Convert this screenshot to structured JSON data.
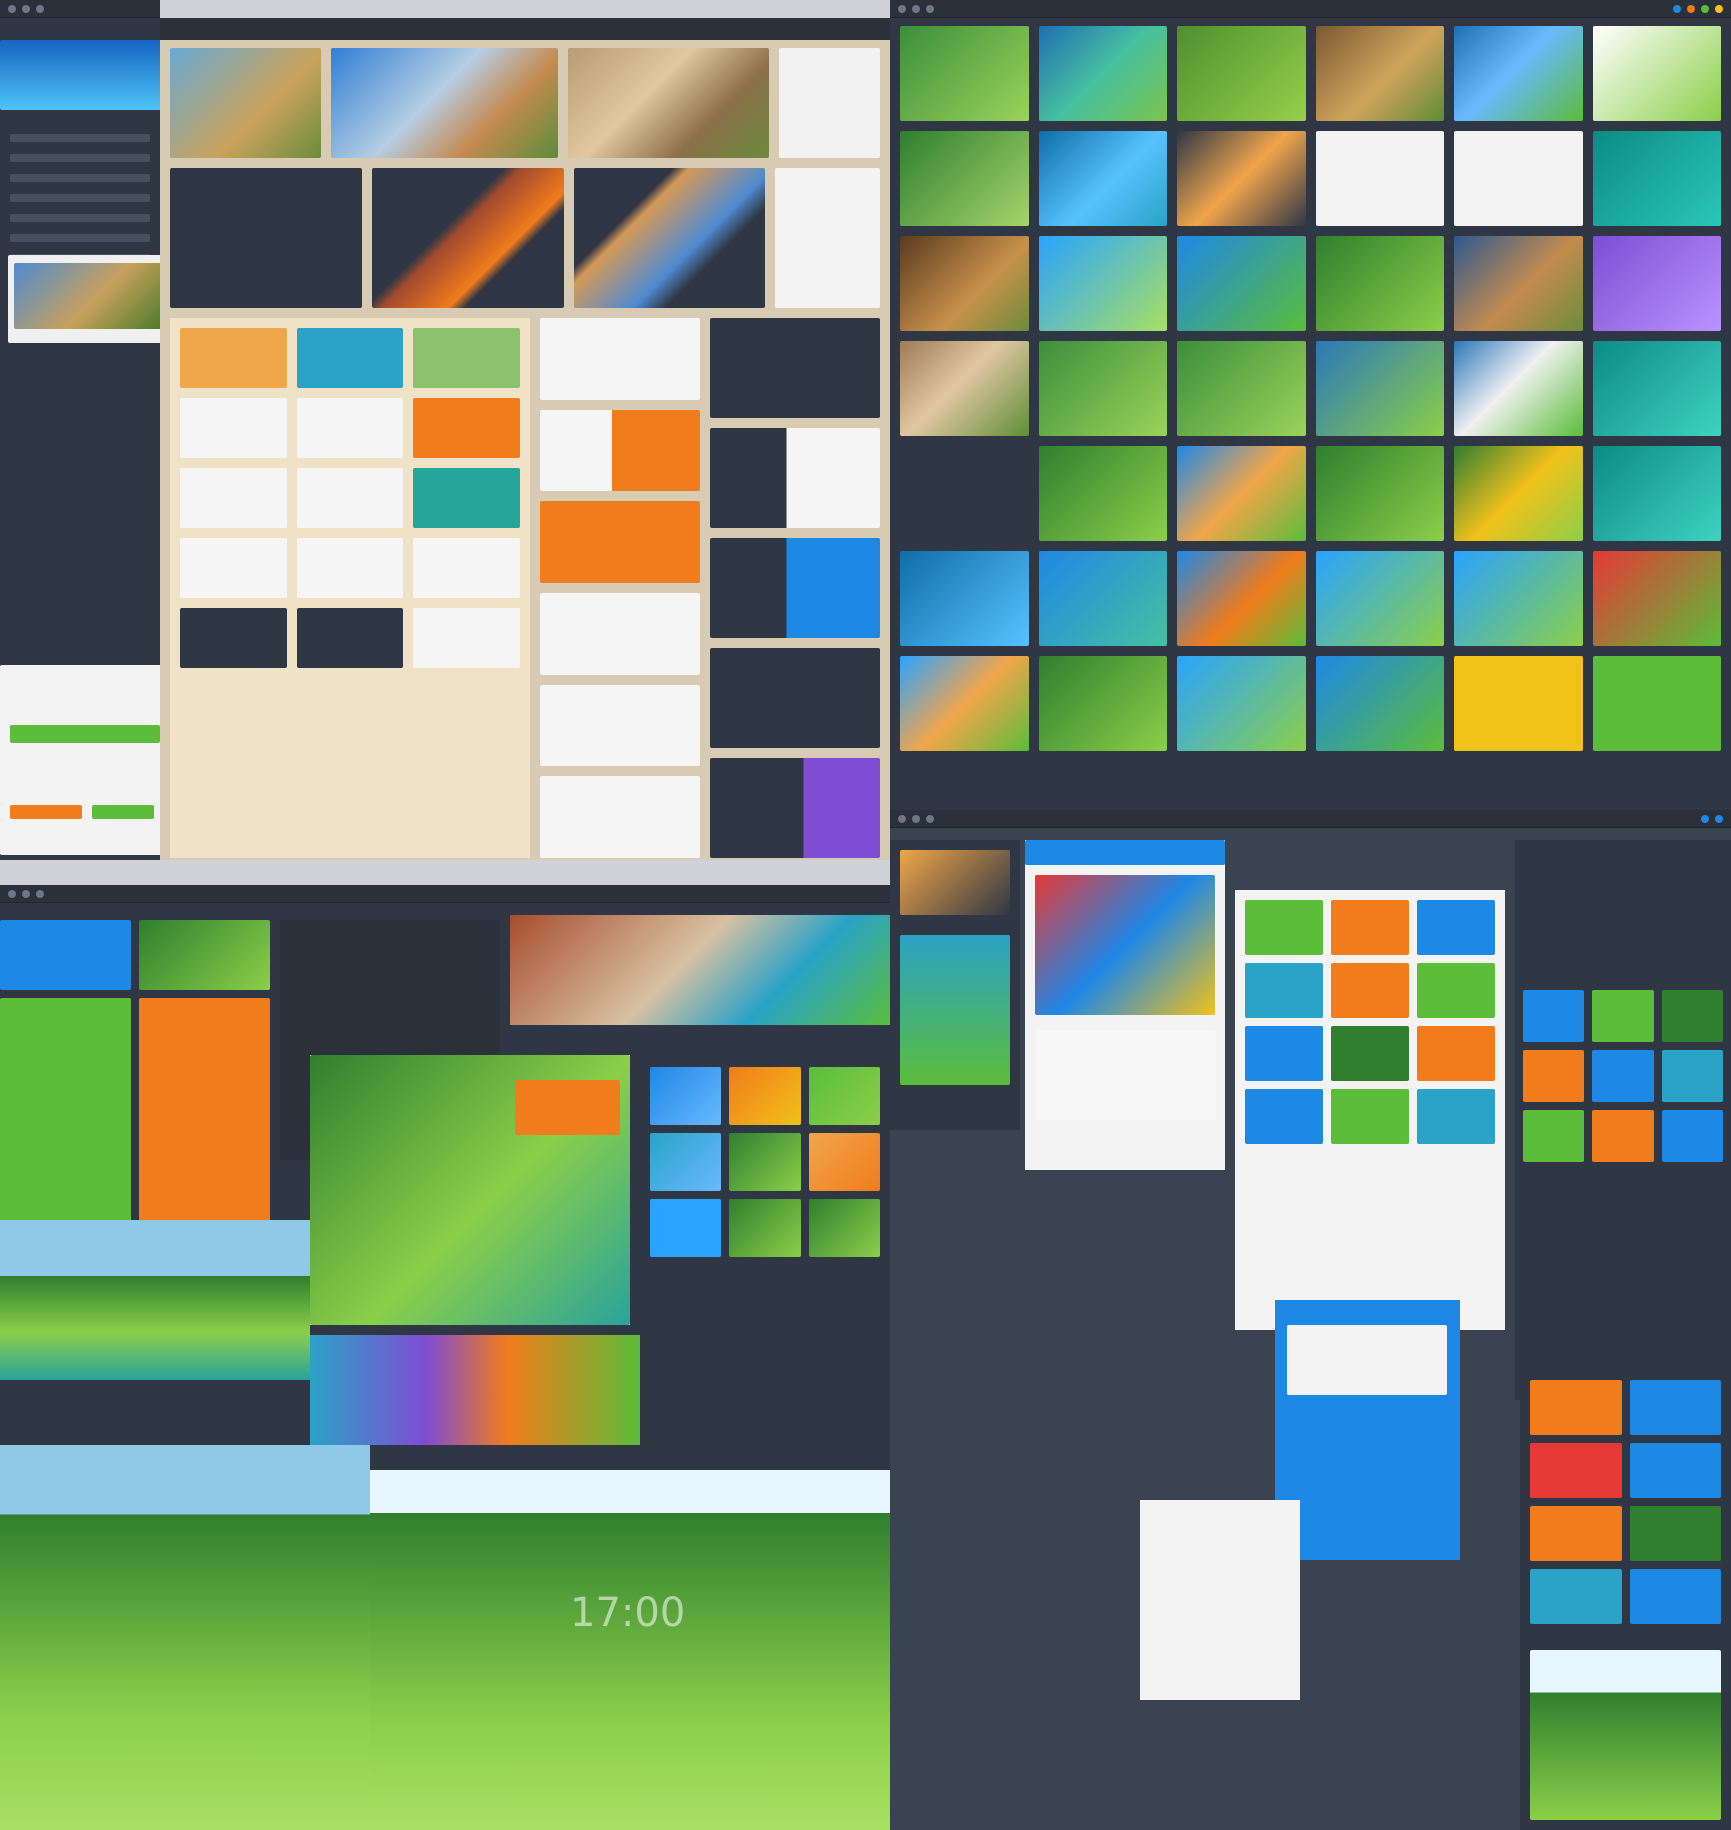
{
  "desktop": {
    "clock_text": "17:00",
    "colors": {
      "bg": "#cfd3d8",
      "panel_dark": "#2f3744",
      "panel_mid": "#3a4350",
      "beige": "#d8ccb1",
      "white": "#f4f4f4",
      "blue": "#1e88e5",
      "orange": "#f07c1b",
      "green": "#5bbd3a",
      "purple": "#7e4dd3",
      "yellow": "#f0c21a",
      "teal": "#26a69a"
    },
    "icons": [
      "grid-icon",
      "image-icon",
      "folder-icon"
    ]
  }
}
